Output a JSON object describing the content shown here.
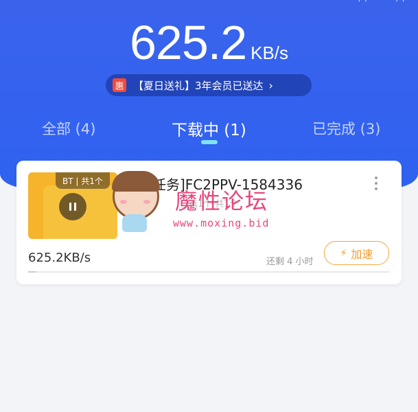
{
  "header": {
    "speed_value": "625.2",
    "speed_unit": "KB/s",
    "promo_badge": "惠",
    "promo_text": "【夏日送礼】3年会员已送达",
    "promo_chevron": "›"
  },
  "tabs": [
    {
      "label": "全部 (4)",
      "active": false
    },
    {
      "label": "下载中 (1)",
      "active": true
    },
    {
      "label": "已完成 (3)",
      "active": false
    }
  ],
  "task": {
    "thumb_tag": "BT | 共1个",
    "title": "任务]FC2PPV-1584336",
    "subtitle": "已选1个 共1个",
    "speed": "625.2KB/s",
    "remaining": "还剩 4 小时",
    "accelerate_label": "加速",
    "progress": 0.02
  },
  "watermark": {
    "text": "魔性论坛",
    "url": "www.moxing.bid"
  },
  "colors": {
    "header_blue": "#3a63ec",
    "accent_orange": "#f49a2a",
    "indicator_cyan": "#7fe3ff",
    "watermark_pink": "#e8457a"
  }
}
